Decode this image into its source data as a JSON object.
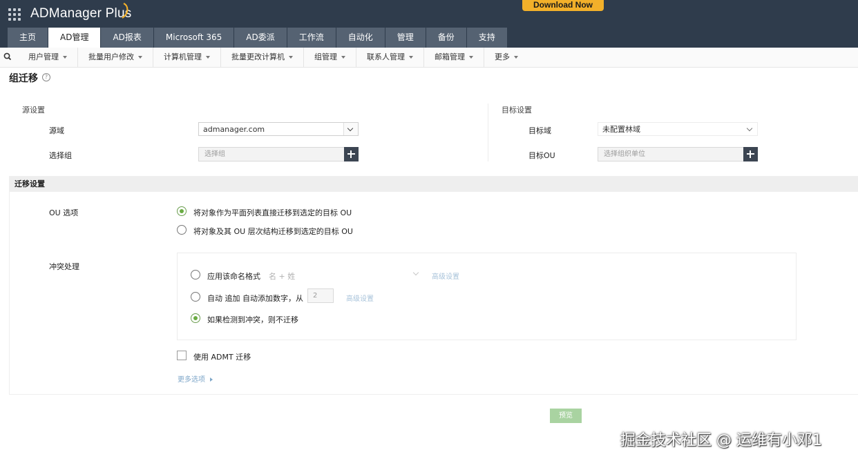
{
  "header": {
    "brand": "ADManager Plus",
    "download_label": "Download Now",
    "tabs": [
      "主页",
      "AD管理",
      "AD报表",
      "Microsoft 365",
      "AD委派",
      "工作流",
      "自动化",
      "管理",
      "备份",
      "支持"
    ],
    "active_tab": "AD管理"
  },
  "subnav": {
    "items": [
      "用户管理",
      "批量用户修改",
      "计算机管理",
      "批量更改计算机",
      "组管理",
      "联系人管理",
      "邮箱管理",
      "更多"
    ]
  },
  "page": {
    "title": "组迁移"
  },
  "source": {
    "section_label": "源设置",
    "domain_label": "源域",
    "domain_value": "admanager.com",
    "group_label": "选择组",
    "group_placeholder": "选择组"
  },
  "target": {
    "section_label": "目标设置",
    "domain_label": "目标域",
    "domain_value": "未配置林域",
    "ou_label": "目标OU",
    "ou_placeholder": "选择组织单位"
  },
  "migration": {
    "section_title": "迁移设置",
    "ou_options_label": "OU 选项",
    "ou_option_1": "将对象作为平面列表直接迁移到选定的目标 OU",
    "ou_option_2": "将对象及其 OU 层次结构迁移到选定的目标 OU",
    "ou_option_selected": 1,
    "conflict_label": "冲突处理",
    "conflict_option_1": "应用该命名格式",
    "conflict_format_value": "名 + 姓",
    "advanced_1": "高级设置",
    "conflict_option_2_prefix": "自动",
    "conflict_option_2_mid": "追加",
    "conflict_option_2_suffix": "自动添加数字，从",
    "auto_number": "2",
    "advanced_2": "高级设置",
    "conflict_option_3": "如果检测到冲突，则不迁移",
    "conflict_option_selected": 3,
    "admt_label": "使用 ADMT 迁移",
    "admt_checked": false,
    "more_options": "更多选项"
  },
  "actions": {
    "preview_label": "预览"
  },
  "watermark": "掘金技术社区 @ 运维有小邓1"
}
